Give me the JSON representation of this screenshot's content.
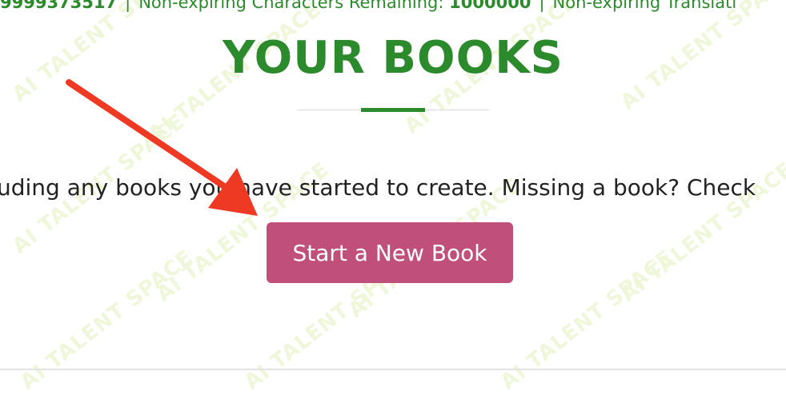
{
  "stats_bar": {
    "prefix_number": "9999373517",
    "label_characters": "Non-expiring Characters Remaining:",
    "characters_remaining": "1000000",
    "label_translations": "Non-expiring Translati"
  },
  "heading": {
    "title": "YOUR BOOKS"
  },
  "intro": {
    "text": "uding any books you have started to create. Missing a book? Check"
  },
  "actions": {
    "new_book_label": "Start a New Book"
  },
  "watermark": {
    "text": "AI TALENT SPACE"
  },
  "colors": {
    "brand_green": "#2b8a2b",
    "button_pink": "#c04f7b",
    "arrow_red": "#ee3a22",
    "watermark": "#eef7d6"
  },
  "annotation": {
    "icon": "red-pointer-arrow"
  }
}
